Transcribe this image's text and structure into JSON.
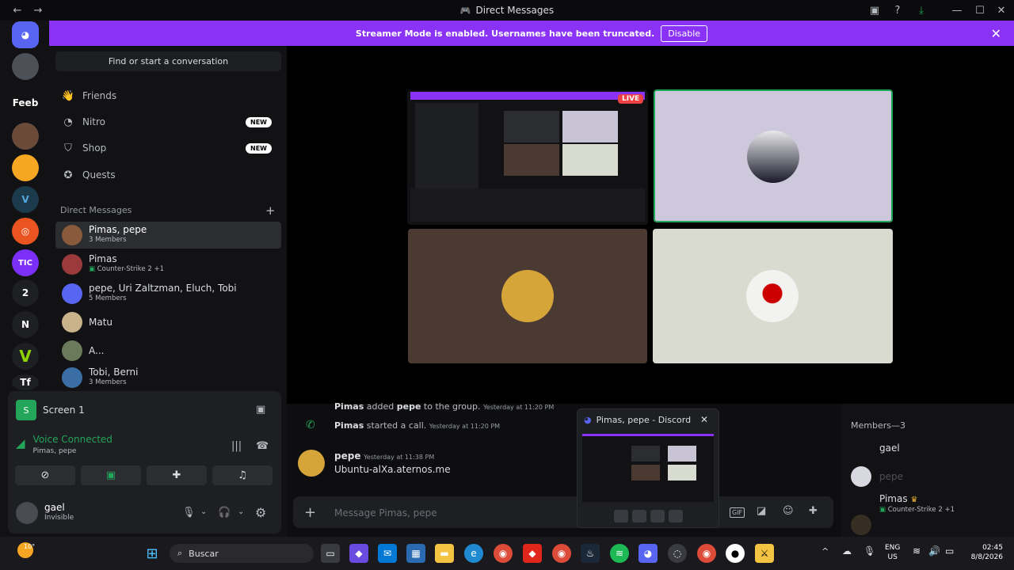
{
  "window": {
    "title": "Direct Messages"
  },
  "banner": {
    "text": "Streamer Mode is enabled. Usernames have been truncated.",
    "button": "Disable"
  },
  "servers": [
    "Feeb",
    "2",
    "N",
    "Tf"
  ],
  "sidebar": {
    "search_placeholder": "Find or start a conversation",
    "nav": [
      {
        "label": "Friends"
      },
      {
        "label": "Nitro",
        "badge": "NEW"
      },
      {
        "label": "Shop",
        "badge": "NEW"
      },
      {
        "label": "Quests"
      }
    ],
    "dm_header": "Direct Messages",
    "dms": [
      {
        "name": "Pimas, pepe",
        "sub": "3 Members"
      },
      {
        "name": "Pimas",
        "sub": "Counter-Strike 2 +1"
      },
      {
        "name": "pepe, Uri Zaltzman, Eluch, Tobi",
        "sub": "5 Members"
      },
      {
        "name": "Matu",
        "sub": ""
      },
      {
        "name": "A...",
        "sub": ""
      },
      {
        "name": "Tobi, Berni",
        "sub": "3 Members"
      }
    ]
  },
  "panel": {
    "screen_label": "Screen 1",
    "voice_status": "Voice Connected",
    "voice_channel": "Pimas, pepe",
    "user_name": "gael",
    "user_status": "Invisible"
  },
  "call": {
    "live_badge": "LIVE"
  },
  "chat": {
    "messages": [
      {
        "author": "Pimas",
        "text": "added",
        "target": "pepe",
        "rest": "to the group.",
        "time": "Yesterday at 11:20 PM"
      },
      {
        "author": "Pimas",
        "text": "started a call.",
        "time": "Yesterday at 11:20 PM"
      },
      {
        "author": "pepe",
        "time": "Yesterday at 11:38 PM",
        "body": "Ubuntu-alXa.aternos.me"
      }
    ],
    "composer_placeholder": "Message Pimas, pepe"
  },
  "popup": {
    "title": "Pimas, pepe - Discord"
  },
  "members": {
    "header": "Members—3",
    "list": [
      {
        "name": "gael",
        "sub": ""
      },
      {
        "name": "pepe",
        "sub": ""
      },
      {
        "name": "Pimas",
        "sub": "Counter-Strike 2 +1"
      }
    ]
  },
  "taskbar": {
    "weather": "10°",
    "search": "Buscar",
    "lang": "ENG",
    "region": "US",
    "time": "02:45",
    "date": "8/8/2026"
  }
}
